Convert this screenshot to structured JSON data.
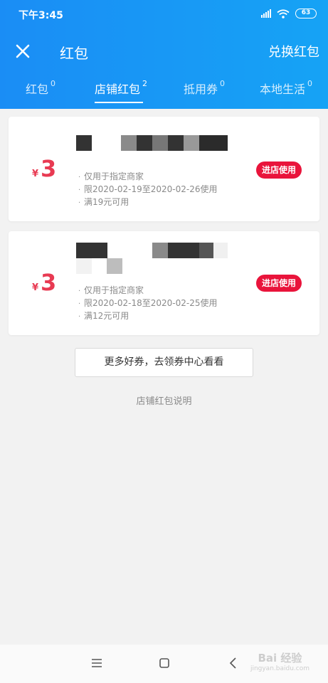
{
  "status_bar": {
    "time": "下午3:45",
    "battery": "63"
  },
  "nav": {
    "title": "红包",
    "action": "兑换红包"
  },
  "tabs": [
    {
      "label": "红包",
      "count": "0"
    },
    {
      "label": "店铺红包",
      "count": "2"
    },
    {
      "label": "抵用券",
      "count": "0"
    },
    {
      "label": "本地生活",
      "count": "0"
    }
  ],
  "vouchers": [
    {
      "currency": "¥",
      "amount": "3",
      "terms": [
        "仅用于指定商家",
        "限2020-02-19至2020-02-26使用",
        "满19元可用"
      ],
      "button": "进店使用"
    },
    {
      "currency": "¥",
      "amount": "3",
      "terms": [
        "仅用于指定商家",
        "限2020-02-18至2020-02-25使用",
        "满12元可用"
      ],
      "button": "进店使用"
    }
  ],
  "more_button": "更多好券，去领券中心看看",
  "explain_link": "店铺红包说明",
  "watermark": {
    "main": "Bai 经验",
    "sub": "jingyan.baidu.com"
  },
  "colors": {
    "header": "#1a8df5",
    "price": "#e83a52",
    "use_button": "#e9143b"
  }
}
